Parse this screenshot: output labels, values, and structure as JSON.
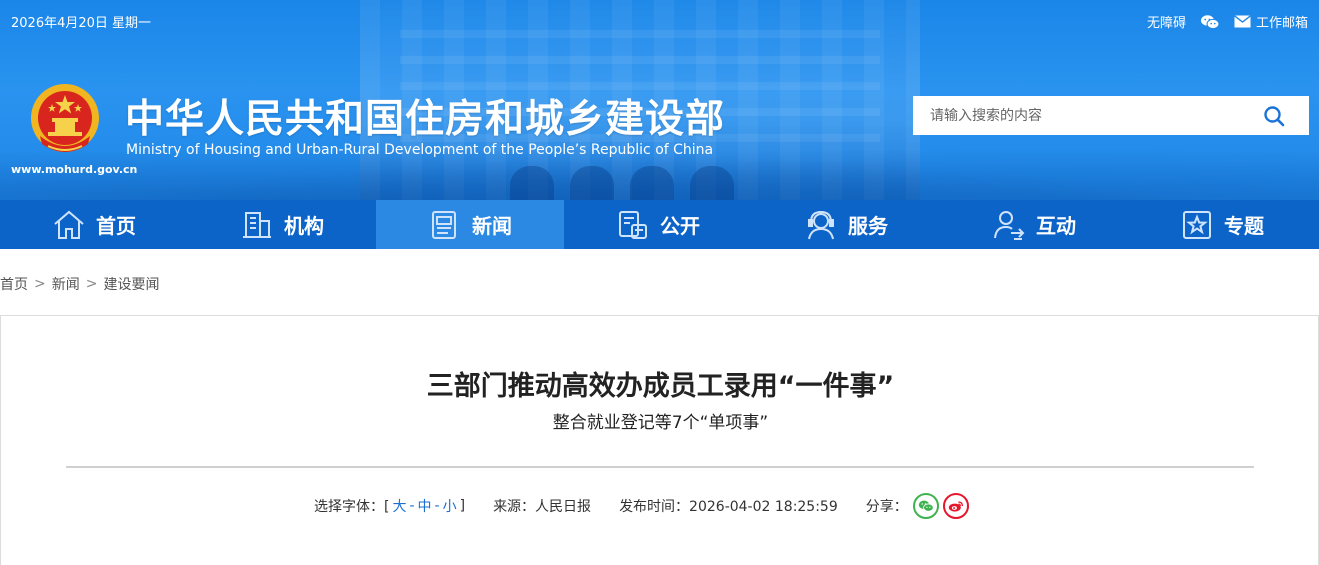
{
  "topbar": {
    "date": "2026年4月20日 星期一",
    "accessibility": "无障碍",
    "work_mail": "工作邮箱"
  },
  "site": {
    "url": "www.mohurd.gov.cn",
    "title": "中华人民共和国住房和城乡建设部",
    "subtitle": "Ministry of Housing and Urban-Rural Development of the People’s Republic of China"
  },
  "search": {
    "placeholder": "请输入搜索的内容"
  },
  "nav": {
    "items": [
      {
        "label": "首页",
        "icon": "home-icon"
      },
      {
        "label": "机构",
        "icon": "building-icon"
      },
      {
        "label": "新闻",
        "icon": "news-icon",
        "active": true
      },
      {
        "label": "公开",
        "icon": "document-icon"
      },
      {
        "label": "服务",
        "icon": "service-icon"
      },
      {
        "label": "互动",
        "icon": "interact-icon"
      },
      {
        "label": "专题",
        "icon": "star-icon"
      }
    ]
  },
  "breadcrumb": {
    "items": [
      "首页",
      "新闻",
      "建设要闻"
    ],
    "separator": ">"
  },
  "article": {
    "title": "三部门推动高效办成员工录用“一件事”",
    "subtitle": "整合就业登记等7个“单项事”",
    "font_label": "选择字体：[",
    "font_large": "大",
    "font_medium": "中",
    "font_small": "小",
    "font_dash": "-",
    "font_close": "]",
    "source": "来源：人民日报",
    "publish_time": "发布时间：2026-04-02 18:25:59",
    "share_label": "分享："
  },
  "colors": {
    "header_blue": "#1a86e8",
    "nav_blue": "#0c64c9",
    "nav_active": "#2b88e3",
    "link_blue": "#1a6fd1",
    "wechat_green": "#3fb34f",
    "weibo_red": "#e6162d"
  }
}
